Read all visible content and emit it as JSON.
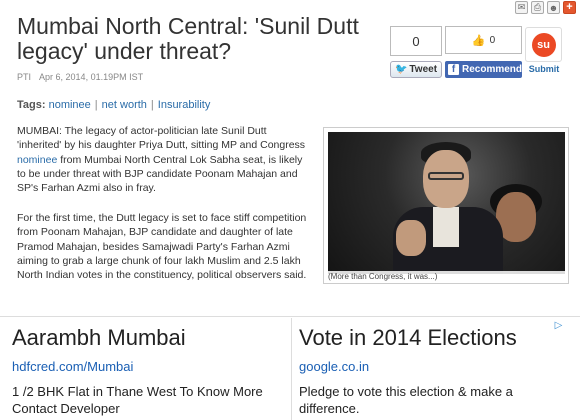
{
  "top_icons": [
    {
      "name": "email-icon",
      "glyph": "✉"
    },
    {
      "name": "print-icon",
      "glyph": "⎙"
    },
    {
      "name": "reddit-icon",
      "glyph": "☻"
    },
    {
      "name": "plus-icon",
      "glyph": "+"
    }
  ],
  "article": {
    "headline": "Mumbai North Central: 'Sunil Dutt legacy' under threat?",
    "source": "PTI",
    "date": "Apr 6, 2014, 01.19PM IST",
    "tags_label": "Tags:",
    "tags": [
      "nominee",
      "net worth",
      "Insurability"
    ],
    "p1_before": "MUMBAI: The legacy of actor-politician late Sunil Dutt 'inherited' by his daughter Priya Dutt, sitting MP and Congress ",
    "p1_link": "nominee",
    "p1_after": " from Mumbai North Central Lok Sabha seat, is likely to be under threat with BJP candidate Poonam Mahajan and SP's Farhan Azmi also in fray.",
    "p2": "For the first time, the Dutt legacy is set to face stiff competition from Poonam Mahajan, BJP candidate and daughter of late Pramod Mahajan, besides Samajwadi Party's Farhan Azmi aiming to grab a large chunk of four lakh Muslim and 2.5 lakh North Indian votes in the constituency, political observers said.",
    "photo_caption": "(More than Congress, it was...)"
  },
  "share": {
    "tweet_count": "0",
    "tweet_label": "Tweet",
    "fb_count": "0",
    "fb_label": "Recommend",
    "stumble_label": "Submit"
  },
  "ads": [
    {
      "title": "Aarambh Mumbai",
      "url": "hdfcred.com/Mumbai",
      "desc": "1 /2 BHK Flat in Thane West To Know More Contact Developer"
    },
    {
      "title": "Vote in 2014 Elections",
      "url": "google.co.in",
      "desc": "Pledge to vote this election & make a difference."
    }
  ]
}
